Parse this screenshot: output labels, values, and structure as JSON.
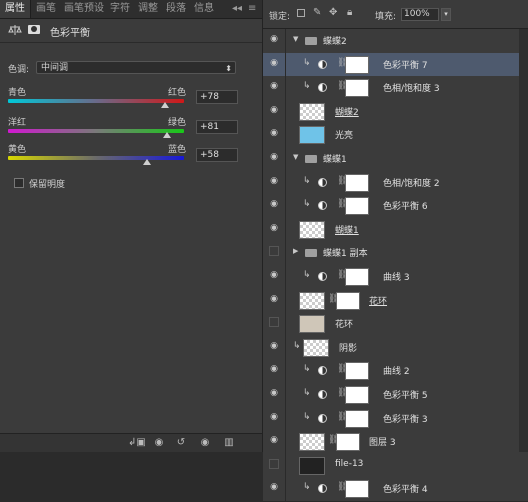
{
  "left_panel": {
    "tabs": [
      "属性",
      "画笔",
      "画笔预设",
      "字符",
      "调整",
      "段落",
      "信息"
    ],
    "collapse_glyph": "◂◂",
    "menu_glyph": "≡",
    "header_title": "色彩平衡",
    "tone": {
      "label": "色调:",
      "value": "中间调"
    },
    "sliders": [
      {
        "left": "青色",
        "right": "红色",
        "value": "+78",
        "level": 78
      },
      {
        "left": "洋红",
        "right": "绿色",
        "value": "+81",
        "level": 81
      },
      {
        "left": "黄色",
        "right": "蓝色",
        "value": "+58",
        "level": 58
      }
    ],
    "preserve_luminosity": "保留明度"
  },
  "right_panel": {
    "lock_label": "锁定:",
    "fill_label": "填充:",
    "fill_value": "100%",
    "layers": [
      {
        "name": "蝶蝶2",
        "kind": "group-open",
        "eye": true
      },
      {
        "name": "色彩平衡 7",
        "kind": "adj",
        "eye": true,
        "clip": true,
        "selected": true
      },
      {
        "name": "色相/饱和度 3",
        "kind": "adj",
        "eye": true,
        "clip": true
      },
      {
        "name": "蝴蝶2",
        "kind": "pixel",
        "eye": true,
        "underline": true
      },
      {
        "name": "光亮",
        "kind": "pixel-blue",
        "eye": true
      },
      {
        "name": "蝶蝶1",
        "kind": "group-open",
        "eye": true
      },
      {
        "name": "色相/饱和度 2",
        "kind": "adj",
        "eye": true,
        "clip": true
      },
      {
        "name": "色彩平衡 6",
        "kind": "adj",
        "eye": true,
        "clip": true
      },
      {
        "name": "蝴蝶1",
        "kind": "pixel",
        "eye": true,
        "underline": true
      },
      {
        "name": "蝶蝶1 副本",
        "kind": "group-closed",
        "eye": false
      },
      {
        "name": "曲线 3",
        "kind": "adj-curve",
        "eye": true,
        "clip": true
      },
      {
        "name": "花环",
        "kind": "pixel-mask",
        "eye": true,
        "underline": true
      },
      {
        "name": "花环",
        "kind": "pixel-wreath",
        "eye": false
      },
      {
        "name": "阴影",
        "kind": "pixel-clip",
        "eye": true,
        "clip": true
      },
      {
        "name": "曲线 2",
        "kind": "adj-curve",
        "eye": true,
        "clip": true
      },
      {
        "name": "色彩平衡 5",
        "kind": "adj",
        "eye": true,
        "clip": true
      },
      {
        "name": "色彩平衡 3",
        "kind": "adj",
        "eye": true,
        "clip": true
      },
      {
        "name": "图层 3",
        "kind": "pixel-mask",
        "eye": true
      },
      {
        "name": "file-13",
        "kind": "pixel-dark",
        "eye": false
      },
      {
        "name": "色彩平衡 4",
        "kind": "adj",
        "eye": true,
        "clip": true
      }
    ]
  },
  "colors": {
    "panel_bg": "#3b3b3b",
    "selected_row": "#4e5a6e"
  }
}
